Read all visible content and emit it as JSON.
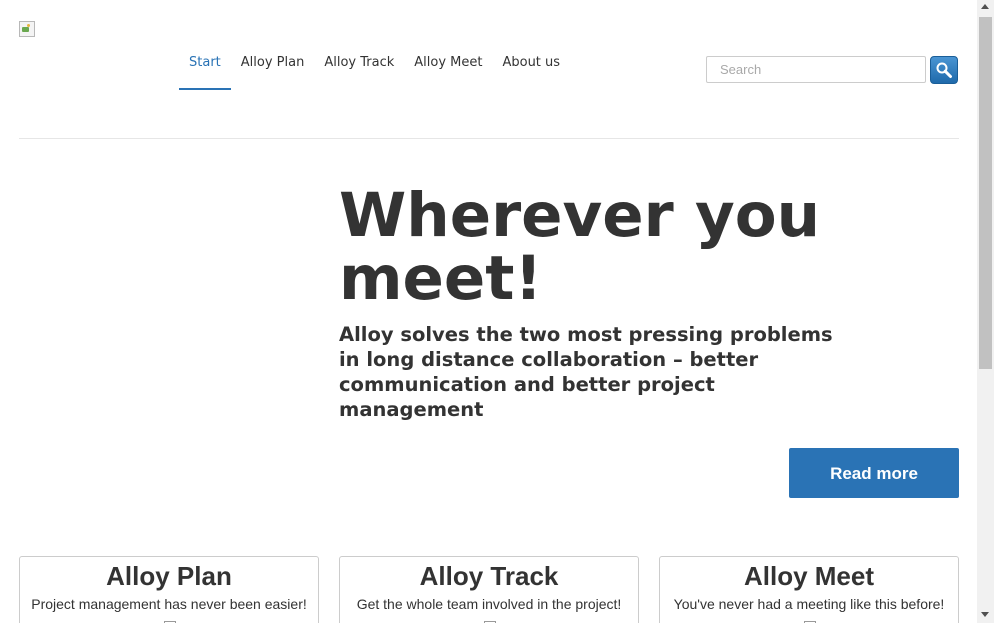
{
  "header": {
    "logo_icon": "broken-image-icon",
    "nav": [
      {
        "label": "Start",
        "active": true
      },
      {
        "label": "Alloy Plan",
        "active": false
      },
      {
        "label": "Alloy Track",
        "active": false
      },
      {
        "label": "Alloy Meet",
        "active": false
      },
      {
        "label": "About us",
        "active": false
      }
    ],
    "search": {
      "placeholder": "Search",
      "value": "",
      "button_icon": "magnifier-icon"
    }
  },
  "hero": {
    "title": "Wherever you meet!",
    "subtitle": "Alloy solves the two most pressing problems in long distance collaboration – better communication and better project management",
    "cta_label": "Read more"
  },
  "cards": [
    {
      "title": "Alloy Plan",
      "text": "Project management has never been easier!"
    },
    {
      "title": "Alloy Track",
      "text": "Get the whole team involved in the project!"
    },
    {
      "title": "Alloy Meet",
      "text": "You've never had a meeting like this before!"
    }
  ],
  "colors": {
    "accent": "#2a73b5",
    "text": "#333333",
    "border": "#cccccc"
  }
}
